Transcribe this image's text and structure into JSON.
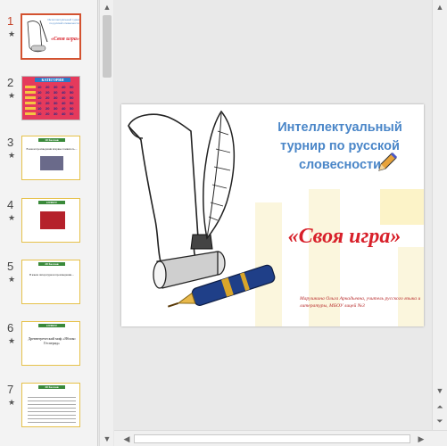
{
  "slide": {
    "title": "Интеллектуальный турнир по русской словесности",
    "game_name": "«Своя игра»",
    "author": "Марушкина Ольга Аркадьевна, учитель русского языка и литературы, МБОУ лицей №3"
  },
  "thumbnails": [
    {
      "number": "1",
      "star": "★",
      "title": "Интеллектуальный турнир по русской словесности",
      "subtitle": "«Своя игра»"
    },
    {
      "number": "2",
      "star": "★",
      "title": "КАТЕГОРИИ",
      "grid_values": [
        "10",
        "20",
        "30",
        "40",
        "50"
      ]
    },
    {
      "number": "3",
      "star": "★",
      "title": "10 баллов",
      "subtitle": "В каком произведении впервые появилось…"
    },
    {
      "number": "4",
      "star": "★",
      "title": "ОТВЕТ",
      "subtitle": ""
    },
    {
      "number": "5",
      "star": "★",
      "title": "20 баллов",
      "subtitle": "В каком литературном произведении…"
    },
    {
      "number": "6",
      "star": "★",
      "title": "ОТВЕТ",
      "subtitle": "Древнегреческий миф «Яблоко Гесперид»"
    },
    {
      "number": "7",
      "star": "★",
      "title": "30 баллов",
      "subtitle": ""
    }
  ],
  "scroll": {
    "up": "▲",
    "down": "▼",
    "left": "◀",
    "right": "▶",
    "page_up": "⏶",
    "page_down": "⏷"
  }
}
